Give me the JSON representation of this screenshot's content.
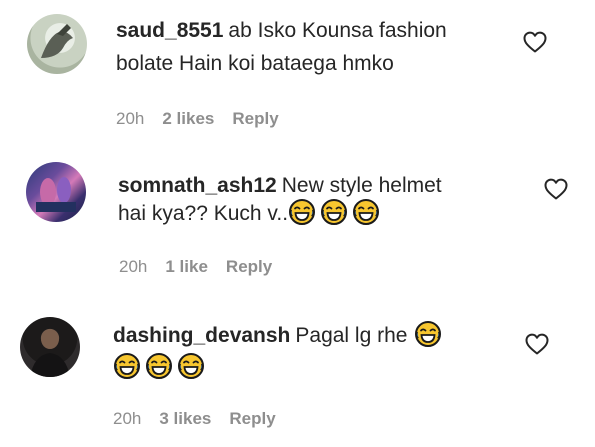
{
  "comments": [
    {
      "username": "saud_8551",
      "text_line1": "ab Isko Kounsa fashion",
      "text_line2": "bolate Hain koi bataega hmko",
      "time": "20h",
      "likes": "2 likes",
      "reply": "Reply",
      "avatar_icon": "user-avatar",
      "heart_icon": "heart-outline-icon"
    },
    {
      "username": "somnath_ash12",
      "text_line1": "New style helmet",
      "text_line2": "hai kya?? Kuch v..",
      "emoji_count": 3,
      "emoji": "face-with-tears-of-joy",
      "time": "20h",
      "likes": "1 like",
      "reply": "Reply",
      "avatar_icon": "user-avatar",
      "heart_icon": "heart-outline-icon"
    },
    {
      "username": "dashing_devansh",
      "text_line1": "Pagal lg rhe",
      "emoji_count": 4,
      "emoji": "face-with-tears-of-joy",
      "time": "20h",
      "likes": "3 likes",
      "reply": "Reply",
      "avatar_icon": "user-avatar",
      "heart_icon": "heart-outline-icon"
    }
  ]
}
